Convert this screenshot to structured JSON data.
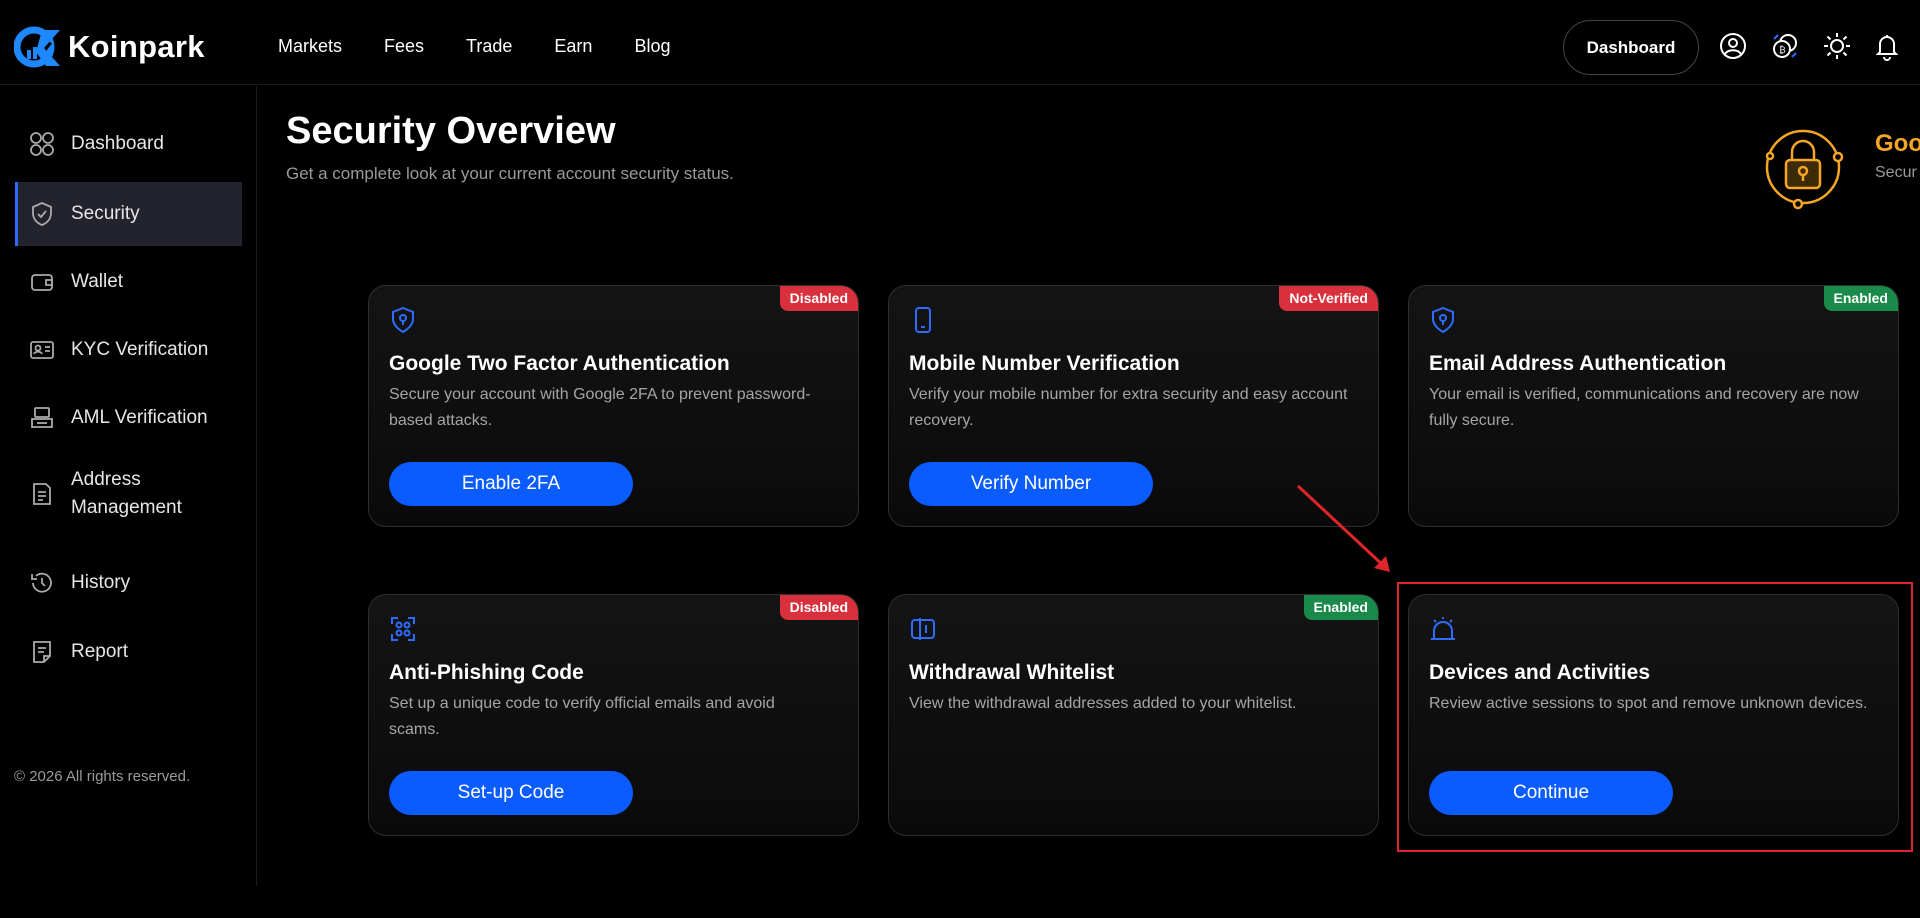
{
  "brand": {
    "name": "Koinpark"
  },
  "nav": {
    "items": [
      "Markets",
      "Fees",
      "Trade",
      "Earn",
      "Blog"
    ]
  },
  "header": {
    "dashboard_button": "Dashboard",
    "icons": [
      "user-circle-icon",
      "coin-swap-icon",
      "sun-icon",
      "bell-icon"
    ]
  },
  "sidebar": {
    "items": [
      {
        "label": "Dashboard",
        "icon": "grid-icon",
        "active": false
      },
      {
        "label": "Security",
        "icon": "shield-icon",
        "active": true
      },
      {
        "label": "Wallet",
        "icon": "wallet-icon",
        "active": false
      },
      {
        "label": "KYC Verification",
        "icon": "id-card-icon",
        "active": false
      },
      {
        "label": "AML Verification",
        "icon": "aml-icon",
        "active": false
      },
      {
        "label": "Address Management",
        "icon": "document-icon",
        "active": false
      },
      {
        "label": "History",
        "icon": "history-icon",
        "active": false
      },
      {
        "label": "Report",
        "icon": "report-icon",
        "active": false
      }
    ],
    "copyright": "© 2026 All rights reserved."
  },
  "page": {
    "title": "Security Overview",
    "subtitle": "Get a complete look at your current account security status.",
    "status_title": "Goo",
    "status_sub": "Secur"
  },
  "cards": [
    {
      "title": "Google Two Factor Authentication",
      "desc": "Secure your account with Google 2FA to prevent password-based attacks.",
      "badge": "Disabled",
      "badge_color": "#d8303c",
      "button": "Enable 2FA",
      "icon": "shield-lock-icon"
    },
    {
      "title": "Mobile Number Verification",
      "desc": "Verify your mobile number for extra security and easy account recovery.",
      "badge": "Not-Verified",
      "badge_color": "#d8303c",
      "button": "Verify Number",
      "icon": "mobile-icon"
    },
    {
      "title": "Email Address Authentication",
      "desc": "Your email is verified, communications and recovery are now fully secure.",
      "badge": "Enabled",
      "badge_color": "#1a8a4a",
      "button": "",
      "icon": "shield-lock-icon"
    },
    {
      "title": "Anti-Phishing Code",
      "desc": "Set up a unique code to verify official emails and avoid scams.",
      "badge": "Disabled",
      "badge_color": "#d8303c",
      "button": "Set-up Code",
      "icon": "scan-code-icon"
    },
    {
      "title": "Withdrawal Whitelist",
      "desc": "View the withdrawal addresses added to your whitelist.",
      "badge": "Enabled",
      "badge_color": "#1a8a4a",
      "button": "",
      "icon": "whitelist-icon"
    },
    {
      "title": "Devices and Activities",
      "desc": "Review active sessions to spot and remove unknown devices.",
      "badge": "",
      "badge_color": "",
      "button": "Continue",
      "icon": "alarm-icon"
    }
  ],
  "colors": {
    "accent": "#0a5cff",
    "danger": "#d8303c",
    "success": "#1a8a4a",
    "warning": "#f5a623",
    "highlight": "#e0252d"
  }
}
